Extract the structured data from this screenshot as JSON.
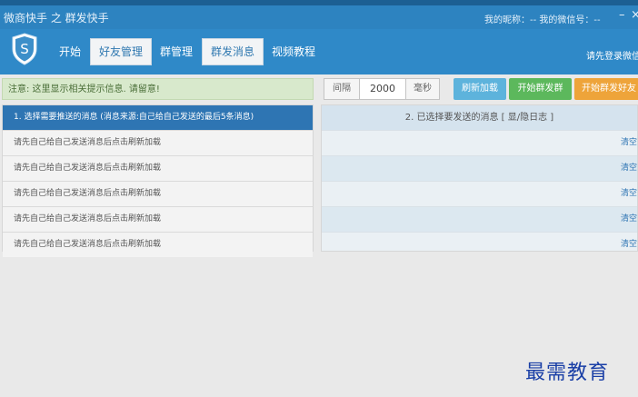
{
  "window": {
    "title": "微商快手 之 群发快手",
    "user_info": "我的昵称：-- 我的微信号：--",
    "minimize": "–",
    "close": "×"
  },
  "nav": {
    "logo_letter": "S",
    "items": [
      {
        "label": "开始"
      },
      {
        "label": "好友管理"
      },
      {
        "label": "群管理"
      },
      {
        "label": "群发消息"
      },
      {
        "label": "视频教程"
      }
    ],
    "login_text": "请先登录微信"
  },
  "toolbar": {
    "notice": "注意: 这里显示相关提示信息. 请留意!",
    "interval_label": "间隔",
    "interval_value": "2000",
    "interval_unit": "毫秒",
    "refresh_label": "刷新加载",
    "send_group_label": "开始群发群",
    "send_friend_label": "开始群发好友"
  },
  "left_panel": {
    "header": "1. 选择需要推送的消息 (消息来源:自己给自己发送的最后5条消息)",
    "rows": [
      "请先自己给自己发送消息后点击刷新加载",
      "请先自己给自己发送消息后点击刷新加载",
      "请先自己给自己发送消息后点击刷新加载",
      "请先自己给自己发送消息后点击刷新加载",
      "请先自己给自己发送消息后点击刷新加载"
    ]
  },
  "right_panel": {
    "header": "2. 已选择要发送的消息 [ 显/隐日志 ]",
    "clear_label": "清空"
  },
  "watermark": "最需教育"
}
